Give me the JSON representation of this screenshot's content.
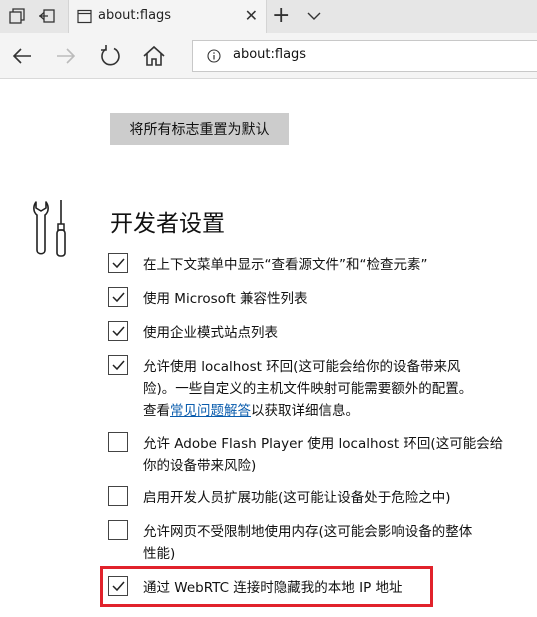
{
  "browser": {
    "tab_title": "about:flags",
    "address": "about:flags"
  },
  "content": {
    "reset_button": "将所有标志重置为默认",
    "section_title": "开发者设置",
    "options": [
      {
        "lines": [
          "在上下文菜单中显示“查看源文件”和“检查元素”"
        ],
        "checked": true
      },
      {
        "lines": [
          "使用 Microsoft 兼容性列表"
        ],
        "checked": true
      },
      {
        "lines": [
          "使用企业模式站点列表"
        ],
        "checked": true
      },
      {
        "lines": [
          "允许使用 localhost 环回(这可能会给你的设备带来风",
          "险)。一些自定义的主机文件映射可能需要额外的配置。"
        ],
        "checked": true,
        "link_prefix": "查看",
        "link_text": "常见问题解答",
        "link_suffix": "以获取详细信息。"
      },
      {
        "lines": [
          "允许 Adobe Flash Player 使用 localhost 环回(这可能会给",
          "你的设备带来风险)"
        ],
        "checked": false
      },
      {
        "lines": [
          "启用开发人员扩展功能(这可能让设备处于危险之中)"
        ],
        "checked": false
      },
      {
        "lines": [
          "允许网页不受限制地使用内存(这可能会影响设备的整体",
          "性能)"
        ],
        "checked": false
      },
      {
        "lines": [
          "通过 WebRTC 连接时隐藏我的本地 IP 地址"
        ],
        "checked": true
      }
    ]
  },
  "colors": {
    "highlight_border": "#e1222b",
    "link": "#0a5cad"
  },
  "icons": [
    "tab-manager-icon",
    "set-aside-tabs-icon",
    "page-icon",
    "close-icon",
    "plus-icon",
    "chevron-down-icon",
    "back-icon",
    "forward-icon",
    "refresh-icon",
    "home-icon",
    "info-icon",
    "developer-tools-icon",
    "checkmark-icon"
  ]
}
